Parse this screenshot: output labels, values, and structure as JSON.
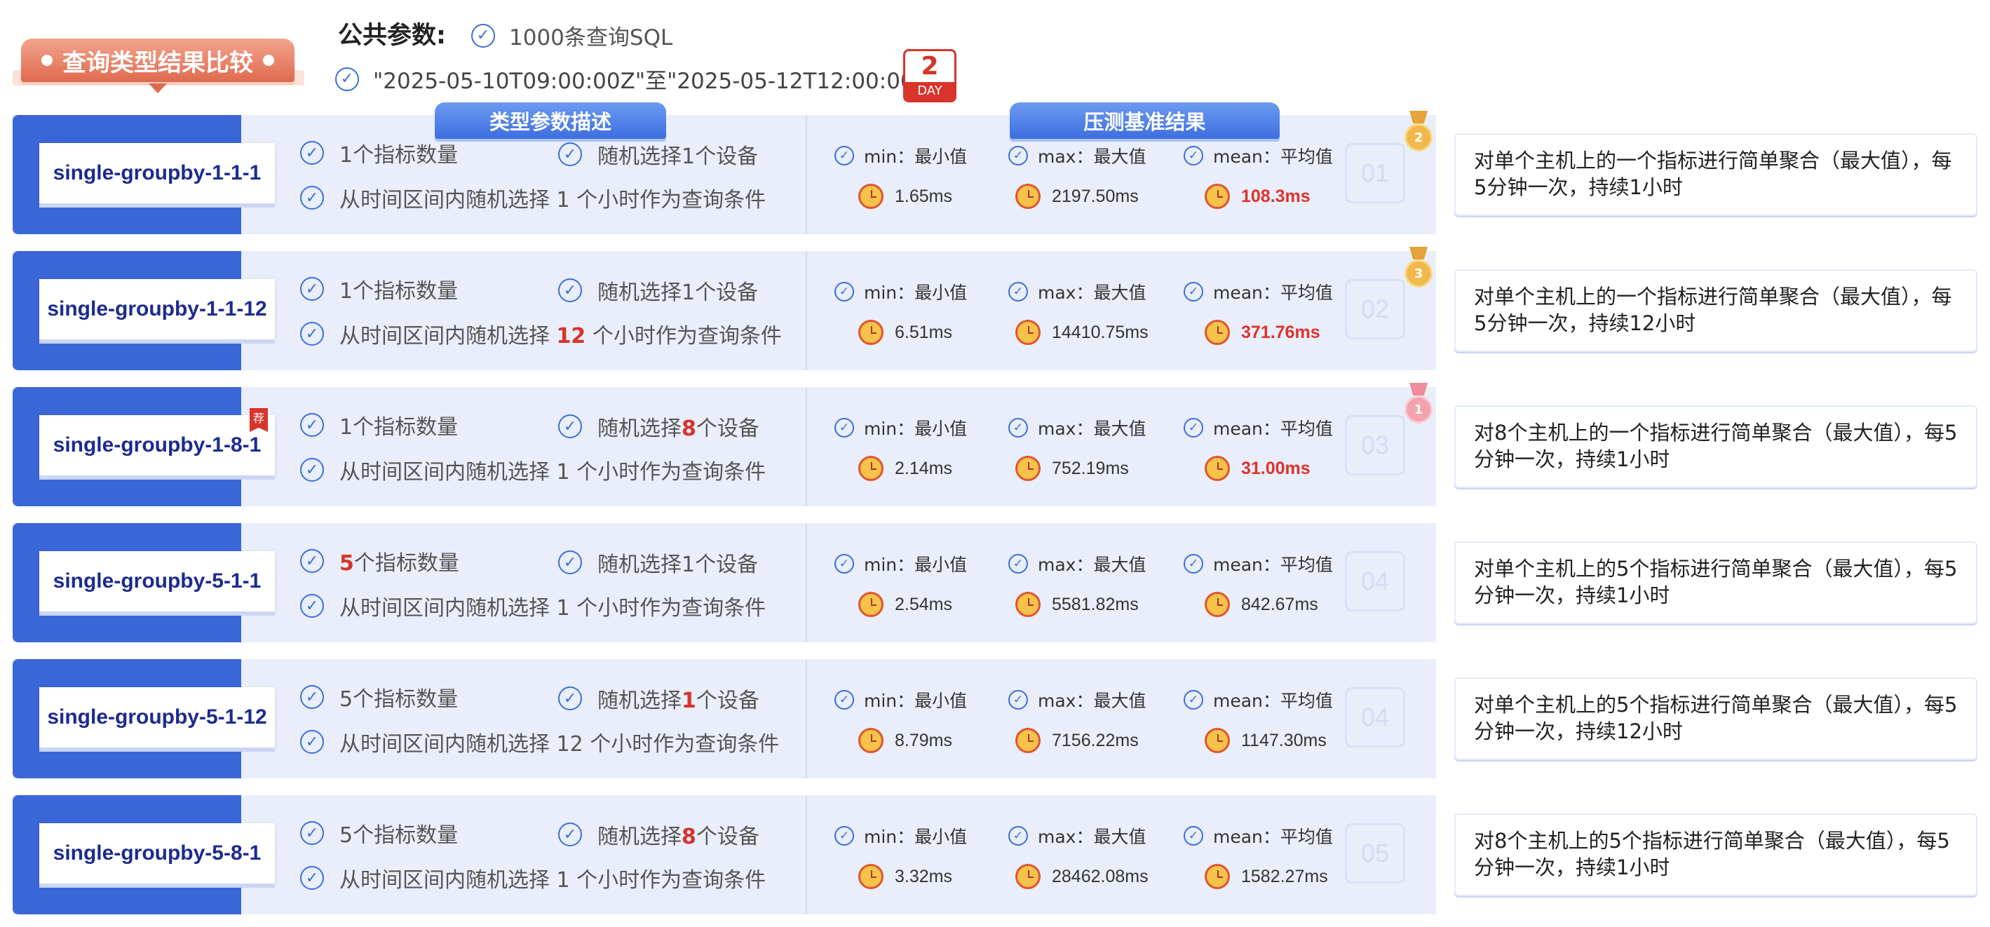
{
  "header": {
    "title": "查询类型结果比较",
    "params_label": "公共参数:",
    "param_sql": "1000条查询SQL",
    "param_range": "\"2025-05-10T09:00:00Z\"至\"2025-05-12T12:00:00Z\"",
    "day_number": "2",
    "day_label": "DAY"
  },
  "tabs": {
    "type_desc": "类型参数描述",
    "bench_result": "压测基准结果"
  },
  "stat_labels": {
    "min": "min：最小值",
    "max": "max：最大值",
    "mean": "mean：平均值"
  },
  "rows": [
    {
      "name": "single-groupby-1-1-1",
      "metrics_pre": "",
      "metrics_hl": "",
      "metrics_post": "1个指标数量",
      "device_pre": "随机选择",
      "device_hl": "",
      "device_post": "1个设备",
      "time_pre": "从时间区间内随机选择 ",
      "time_hl": "",
      "time_post": "1 个小时作为查询条件",
      "min": "1.65ms",
      "max": "2197.50ms",
      "mean": "108.3ms",
      "mean_highlight": true,
      "number": "01",
      "medal": "2",
      "note": "对单个主机上的一个指标进行简单聚合（最大值），每5分钟一次，持续1小时"
    },
    {
      "name": "single-groupby-1-1-12",
      "metrics_pre": "",
      "metrics_hl": "",
      "metrics_post": "1个指标数量",
      "device_pre": "随机选择",
      "device_hl": "",
      "device_post": "1个设备",
      "time_pre": "从时间区间内随机选择 ",
      "time_hl": "12",
      "time_post": " 个小时作为查询条件",
      "min": "6.51ms",
      "max": "14410.75ms",
      "mean": "371.76ms",
      "mean_highlight": true,
      "number": "02",
      "medal": "3",
      "note": "对单个主机上的一个指标进行简单聚合（最大值），每5分钟一次，持续12小时"
    },
    {
      "name": "single-groupby-1-8-1",
      "metrics_pre": "",
      "metrics_hl": "",
      "metrics_post": "1个指标数量",
      "device_pre": "随机选择",
      "device_hl": "8",
      "device_post": "个设备",
      "time_pre": "从时间区间内随机选择 ",
      "time_hl": "",
      "time_post": "1 个小时作为查询条件",
      "min": "2.14ms",
      "max": "752.19ms",
      "mean": "31.00ms",
      "mean_highlight": true,
      "number": "03",
      "medal": "1",
      "tag": "荐",
      "note": "对8个主机上的一个指标进行简单聚合（最大值），每5分钟一次，持续1小时"
    },
    {
      "name": "single-groupby-5-1-1",
      "metrics_pre": "",
      "metrics_hl": "5",
      "metrics_post": "个指标数量",
      "device_pre": "随机选择",
      "device_hl": "",
      "device_post": "1个设备",
      "time_pre": "从时间区间内随机选择 ",
      "time_hl": "",
      "time_post": "1 个小时作为查询条件",
      "min": "2.54ms",
      "max": "5581.82ms",
      "mean": "842.67ms",
      "mean_highlight": false,
      "number": "04",
      "medal": "",
      "note": "对单个主机上的5个指标进行简单聚合（最大值），每5分钟一次，持续1小时"
    },
    {
      "name": "single-groupby-5-1-12",
      "metrics_pre": "",
      "metrics_hl": "",
      "metrics_post": "5个指标数量",
      "device_pre": "随机选择",
      "device_hl": "1",
      "device_post": "个设备",
      "time_pre": "从时间区间内随机选择 ",
      "time_hl": "",
      "time_post": "12 个小时作为查询条件",
      "min": "8.79ms",
      "max": "7156.22ms",
      "mean": "1147.30ms",
      "mean_highlight": false,
      "number": "04",
      "medal": "",
      "note": "对单个主机上的5个指标进行简单聚合（最大值），每5分钟一次，持续12小时"
    },
    {
      "name": "single-groupby-5-8-1",
      "metrics_pre": "",
      "metrics_hl": "",
      "metrics_post": "5个指标数量",
      "device_pre": "随机选择",
      "device_hl": "8",
      "device_post": "个设备",
      "time_pre": "从时间区间内随机选择 ",
      "time_hl": "",
      "time_post": "1 个小时作为查询条件",
      "min": "3.32ms",
      "max": "28462.08ms",
      "mean": "1582.27ms",
      "mean_highlight": false,
      "number": "05",
      "medal": "",
      "note": "对8个主机上的5个指标进行简单聚合（最大值），每5分钟一次，持续1小时"
    }
  ],
  "colors": {
    "accent_blue": "#3b66d8",
    "highlight_red": "#d8342b",
    "title_orange": "#e06a4f"
  }
}
